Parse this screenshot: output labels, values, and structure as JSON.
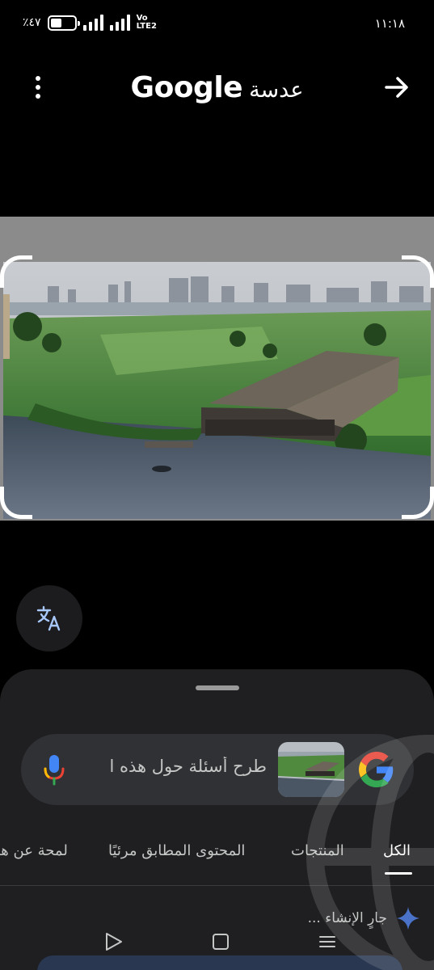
{
  "status_bar": {
    "time": "١١:١٨",
    "battery_percent": "٪٤٧",
    "battery_level": 0.47,
    "network_label_top": "Vo",
    "network_label_bottom": "LTE2"
  },
  "app_bar": {
    "title_brand": "Google",
    "title_product": "عدسة",
    "menu_icon": "more-vert-icon",
    "share_icon": "arrow-right-icon"
  },
  "image": {
    "description_icon": "photo-thumbnail"
  },
  "translate": {
    "icon": "translate-icon"
  },
  "search": {
    "placeholder": "طرح أسئلة حول هذه ا",
    "google_icon": "google-g-icon",
    "mic_icon": "mic-icon"
  },
  "tabs": [
    {
      "label": "الكل",
      "active": true
    },
    {
      "label": "المنتجات",
      "active": false
    },
    {
      "label": "المحتوى المطابق مرئيًا",
      "active": false
    },
    {
      "label": "لمحة عن هـ",
      "active": false
    }
  ],
  "generating": {
    "label": "جارٍ الإنشاء ...",
    "icon": "sparkle-icon"
  },
  "colors": {
    "background": "#000000",
    "sheet": "#1f1f21",
    "searchbar": "#303134",
    "google_blue": "#4285F4",
    "google_red": "#EA4335",
    "google_yellow": "#FBBC05",
    "google_green": "#34A853"
  }
}
